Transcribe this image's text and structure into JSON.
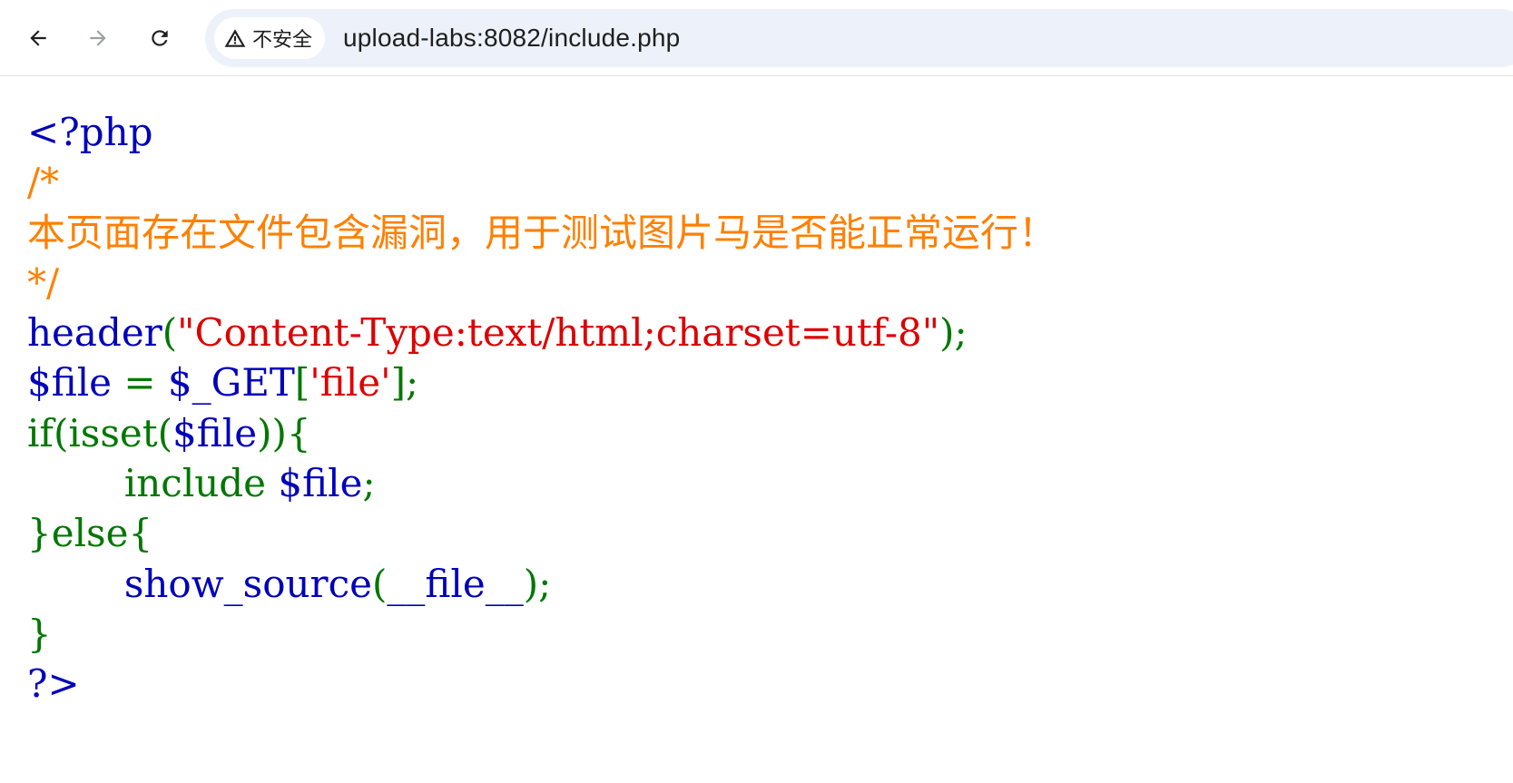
{
  "browser": {
    "security_label": "不安全",
    "url": "upload-labs:8082/include.php",
    "icons": {
      "back": "arrow-left-icon",
      "forward": "arrow-right-icon",
      "reload": "reload-icon",
      "warning": "warning-triangle-icon"
    }
  },
  "colors": {
    "default": "#0000BB",
    "comment": "#FF8000",
    "string": "#DD0000",
    "keyword": "#007700"
  },
  "code": {
    "l1": {
      "a": "<?php"
    },
    "l2": {
      "a": "/*"
    },
    "l3": {
      "a": "本页面存在文件包含漏洞，用于测试图片马是否能正常运行！"
    },
    "l4": {
      "a": "*/"
    },
    "l5": {
      "a": "header",
      "b": "(",
      "c": "\"Content-Type:text/html;charset=utf-8\"",
      "d": ");"
    },
    "l6": {
      "a": "$file ",
      "b": "= ",
      "c": "$_GET",
      "d": "[",
      "e": "'file'",
      "f": "];"
    },
    "l7": {
      "a": "if(isset(",
      "b": "$file",
      "c": ")){"
    },
    "l8": {
      "indent": "        ",
      "a": "include ",
      "b": "$file",
      "c": ";"
    },
    "l9": {
      "a": "}else{"
    },
    "l10": {
      "indent": "        ",
      "a": "show_source",
      "b": "(",
      "c": "__file__",
      "d": ");"
    },
    "l11": {
      "a": "}"
    },
    "l12": {
      "a": "?>"
    }
  }
}
